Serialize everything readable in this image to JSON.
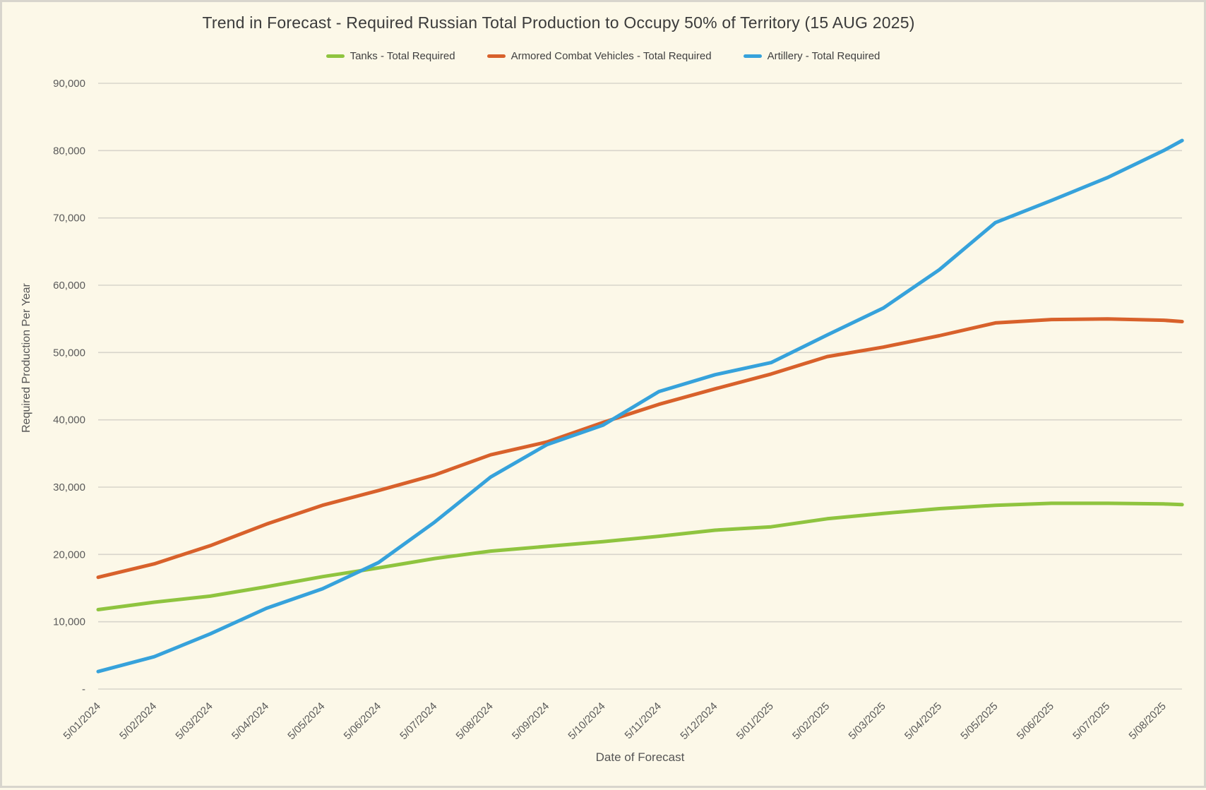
{
  "chart": {
    "title": "Trend in Forecast - Required Russian Total Production to Occupy 50% of Territory (15 AUG 2025)",
    "legend": [
      {
        "label": "Tanks - Total Required",
        "color": "#8FC43F"
      },
      {
        "label": "Armored Combat Vehicles - Total Required",
        "color": "#D8612B"
      },
      {
        "label": "Artillery - Total Required",
        "color": "#36A2DB"
      }
    ],
    "x_axis": {
      "title": "Date of Forecast"
    },
    "y_axis": {
      "title": "Required Production Per Year",
      "tick_labels": [
        "-",
        "10,000",
        "20,000",
        "30,000",
        "40,000",
        "50,000",
        "60,000",
        "70,000",
        "80,000",
        "90,000"
      ]
    }
  },
  "chart_data": {
    "type": "line",
    "title": "Trend in Forecast - Required Russian Total Production to Occupy 50% of Territory (15 AUG 2025)",
    "xlabel": "Date of Forecast",
    "ylabel": "Required Production Per Year",
    "ylim": [
      0,
      90000
    ],
    "y_tick_step": 10000,
    "grid": true,
    "legend_position": "top",
    "categories": [
      "5/01/2024",
      "5/02/2024",
      "5/03/2024",
      "5/04/2024",
      "5/05/2024",
      "5/06/2024",
      "5/07/2024",
      "5/08/2024",
      "5/09/2024",
      "5/10/2024",
      "5/11/2024",
      "5/12/2024",
      "5/01/2025",
      "5/02/2025",
      "5/03/2025",
      "5/04/2025",
      "5/05/2025",
      "5/06/2025",
      "5/07/2025",
      "5/08/2025"
    ],
    "final_point_offset_months": 0.33,
    "series": [
      {
        "name": "Tanks - Total Required",
        "color": "#8FC43F",
        "values": [
          11800,
          12900,
          13800,
          15200,
          16700,
          18000,
          19400,
          20500,
          21200,
          21900,
          22700,
          23600,
          24100,
          25300,
          26100,
          26800,
          27300,
          27600,
          27600,
          27500,
          27400
        ]
      },
      {
        "name": "Armored Combat Vehicles - Total Required",
        "color": "#D8612B",
        "values": [
          16600,
          18600,
          21300,
          24500,
          27300,
          29500,
          31800,
          34800,
          36700,
          39600,
          42300,
          44600,
          46800,
          49400,
          50800,
          52500,
          54400,
          54900,
          55000,
          54800,
          54600
        ]
      },
      {
        "name": "Artillery - Total Required",
        "color": "#36A2DB",
        "values": [
          2600,
          4800,
          8200,
          12000,
          14900,
          18800,
          24800,
          31500,
          36300,
          39200,
          44200,
          46700,
          48500,
          52600,
          56600,
          62300,
          69300,
          72600,
          76000,
          80000,
          81500
        ]
      }
    ]
  }
}
